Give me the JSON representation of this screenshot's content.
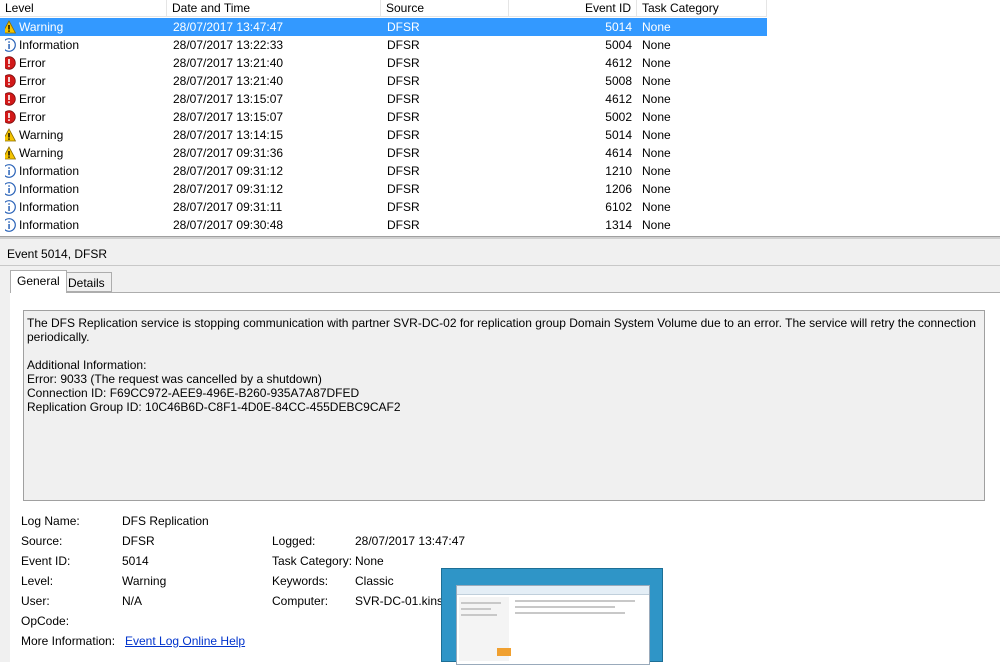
{
  "columns": {
    "level": "Level",
    "date_time": "Date and Time",
    "source": "Source",
    "event_id": "Event ID",
    "task_category": "Task Category"
  },
  "rows": [
    {
      "level": "Warning",
      "type": "warning",
      "date": "28/07/2017 13:47:47",
      "source": "DFSR",
      "id": "5014",
      "category": "None",
      "selected": true
    },
    {
      "level": "Information",
      "type": "info",
      "date": "28/07/2017 13:22:33",
      "source": "DFSR",
      "id": "5004",
      "category": "None"
    },
    {
      "level": "Error",
      "type": "error",
      "date": "28/07/2017 13:21:40",
      "source": "DFSR",
      "id": "4612",
      "category": "None"
    },
    {
      "level": "Error",
      "type": "error",
      "date": "28/07/2017 13:21:40",
      "source": "DFSR",
      "id": "5008",
      "category": "None"
    },
    {
      "level": "Error",
      "type": "error",
      "date": "28/07/2017 13:15:07",
      "source": "DFSR",
      "id": "4612",
      "category": "None"
    },
    {
      "level": "Error",
      "type": "error",
      "date": "28/07/2017 13:15:07",
      "source": "DFSR",
      "id": "5002",
      "category": "None"
    },
    {
      "level": "Warning",
      "type": "warning",
      "date": "28/07/2017 13:14:15",
      "source": "DFSR",
      "id": "5014",
      "category": "None"
    },
    {
      "level": "Warning",
      "type": "warning",
      "date": "28/07/2017 09:31:36",
      "source": "DFSR",
      "id": "4614",
      "category": "None"
    },
    {
      "level": "Information",
      "type": "info",
      "date": "28/07/2017 09:31:12",
      "source": "DFSR",
      "id": "1210",
      "category": "None"
    },
    {
      "level": "Information",
      "type": "info",
      "date": "28/07/2017 09:31:12",
      "source": "DFSR",
      "id": "1206",
      "category": "None"
    },
    {
      "level": "Information",
      "type": "info",
      "date": "28/07/2017 09:31:11",
      "source": "DFSR",
      "id": "6102",
      "category": "None"
    },
    {
      "level": "Information",
      "type": "info",
      "date": "28/07/2017 09:30:48",
      "source": "DFSR",
      "id": "1314",
      "category": "None"
    }
  ],
  "detail": {
    "title": "Event 5014, DFSR",
    "tabs": {
      "general": "General",
      "details": "Details"
    },
    "description": {
      "line1": "The DFS Replication service is stopping communication with partner SVR-DC-02 for replication group Domain System Volume due to an error. The service will retry the connection periodically.",
      "additional_header": "Additional Information:",
      "error": "Error: 9033 (The request was cancelled by a shutdown)",
      "connection_id": "Connection ID: F69CC972-AEE9-496E-B260-935A7A87DFED",
      "group_id": "Replication Group ID: 10C46B6D-C8F1-4D0E-84CC-455DEBC9CAF2"
    },
    "fields": {
      "log_name_label": "Log Name:",
      "log_name": "DFS Replication",
      "source_label": "Source:",
      "source": "DFSR",
      "logged_label": "Logged:",
      "logged": "28/07/2017 13:47:47",
      "event_id_label": "Event ID:",
      "event_id": "5014",
      "task_category_label": "Task Category:",
      "task_category": "None",
      "level_label": "Level:",
      "level": "Warning",
      "keywords_label": "Keywords:",
      "keywords": "Classic",
      "user_label": "User:",
      "user": "N/A",
      "computer_label": "Computer:",
      "computer": "SVR-DC-01.kinso",
      "opcode_label": "OpCode:",
      "opcode": "",
      "more_info_label": "More Information:",
      "more_info_link": "Event Log Online Help"
    }
  },
  "colors": {
    "selection": "#3399ff",
    "warning": "#f5c400",
    "error": "#d11919",
    "info": "#2a63b8",
    "link": "#0033cc",
    "thumbnail_bg": "#2f95c7"
  },
  "icons": {
    "warning": "warning-icon",
    "error": "error-icon",
    "info": "info-icon"
  }
}
